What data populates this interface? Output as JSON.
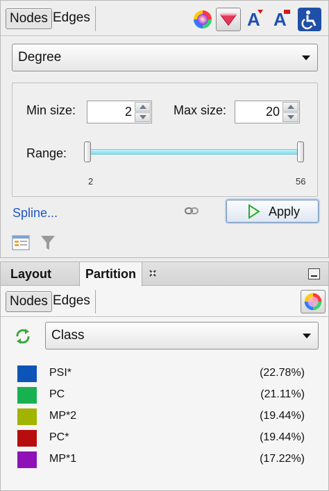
{
  "ranking": {
    "subtabs": [
      "Nodes",
      "Edges"
    ],
    "icons": [
      "color-wheel-icon",
      "size-triangle-icon",
      "label-size-icon",
      "label-color-icon",
      "accessibility-icon"
    ],
    "ranking_attribute": "Degree",
    "min_size": {
      "label": "Min size:",
      "value": "2"
    },
    "max_size": {
      "label": "Max size:",
      "value": "20"
    },
    "range": {
      "label": "Range:",
      "min_label": "2",
      "max_label": "56",
      "low": 2,
      "high": 56
    },
    "spline_link": "Spline...",
    "apply_label": "Apply"
  },
  "partition": {
    "tabs": [
      "Layout",
      "Partition"
    ],
    "subtabs": [
      "Nodes",
      "Edges"
    ],
    "attribute": "Class",
    "legend": [
      {
        "name": "PSI*",
        "pct": "(22.78%)",
        "color": "#0d54b8"
      },
      {
        "name": "PC",
        "pct": "(21.11%)",
        "color": "#17b24f"
      },
      {
        "name": "MP*2",
        "pct": "(19.44%)",
        "color": "#a2b400"
      },
      {
        "name": "PC*",
        "pct": "(19.44%)",
        "color": "#b80d0d"
      },
      {
        "name": "MP*1",
        "pct": "(17.22%)",
        "color": "#8e12b8"
      }
    ]
  }
}
